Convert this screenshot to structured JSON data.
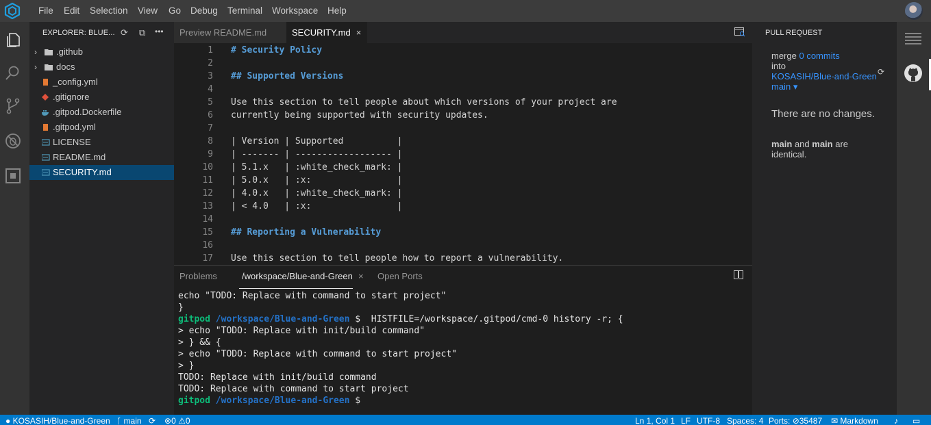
{
  "menu": {
    "items": [
      "File",
      "Edit",
      "Selection",
      "View",
      "Go",
      "Debug",
      "Terminal",
      "Workspace",
      "Help"
    ]
  },
  "activity_bar": {
    "icons": [
      "files-icon",
      "search-icon",
      "source-control-icon",
      "debug-icon",
      "extensions-icon"
    ]
  },
  "explorer": {
    "title": "EXPLORER: BLUE...",
    "items": [
      {
        "label": ".github",
        "type": "folder"
      },
      {
        "label": "docs",
        "type": "folder"
      },
      {
        "label": "_config.yml",
        "type": "yml"
      },
      {
        "label": ".gitignore",
        "type": "git"
      },
      {
        "label": ".gitpod.Dockerfile",
        "type": "docker"
      },
      {
        "label": ".gitpod.yml",
        "type": "yml"
      },
      {
        "label": "LICENSE",
        "type": "text"
      },
      {
        "label": "README.md",
        "type": "text"
      },
      {
        "label": "SECURITY.md",
        "type": "text",
        "selected": true
      }
    ]
  },
  "tabs": [
    {
      "label": "Preview README.md",
      "active": false
    },
    {
      "label": "SECURITY.md",
      "active": true,
      "close": "×"
    }
  ],
  "editor": {
    "lines": [
      {
        "num": "1",
        "text": "# Security Policy",
        "heading": true
      },
      {
        "num": "2",
        "text": ""
      },
      {
        "num": "3",
        "text": "## Supported Versions",
        "heading": true
      },
      {
        "num": "4",
        "text": ""
      },
      {
        "num": "5",
        "text": "Use this section to tell people about which versions of your project are"
      },
      {
        "num": "6",
        "text": "currently being supported with security updates."
      },
      {
        "num": "7",
        "text": ""
      },
      {
        "num": "8",
        "text": "| Version | Supported          |"
      },
      {
        "num": "9",
        "text": "| ------- | ------------------ |"
      },
      {
        "num": "10",
        "text": "| 5.1.x   | :white_check_mark: |"
      },
      {
        "num": "11",
        "text": "| 5.0.x   | :x:                |"
      },
      {
        "num": "12",
        "text": "| 4.0.x   | :white_check_mark: |"
      },
      {
        "num": "13",
        "text": "| < 4.0   | :x:                |"
      },
      {
        "num": "14",
        "text": ""
      },
      {
        "num": "15",
        "text": "## Reporting a Vulnerability",
        "heading": true
      },
      {
        "num": "16",
        "text": ""
      },
      {
        "num": "17",
        "text": "Use this section to tell people how to report a vulnerability."
      }
    ]
  },
  "panel": {
    "tabs": [
      "Problems",
      "/workspace/Blue-and-Green",
      "Open Ports"
    ],
    "active_tab": "/workspace/Blue-and-Green",
    "close": "×",
    "terminal_lines": [
      [
        {
          "t": "echo \"TODO: Replace with command to start project\""
        }
      ],
      [
        {
          "t": "}"
        }
      ],
      [
        {
          "t": "gitpod",
          "c": "green"
        },
        {
          "t": " "
        },
        {
          "t": "/workspace/Blue-and-Green",
          "c": "blue"
        },
        {
          "t": " $  HISTFILE=/workspace/.gitpod/cmd-0 history -r; {"
        }
      ],
      [
        {
          "t": "> echo \"TODO: Replace with init/build command\""
        }
      ],
      [
        {
          "t": "> } && {"
        }
      ],
      [
        {
          "t": "> echo \"TODO: Replace with command to start project\""
        }
      ],
      [
        {
          "t": "> }"
        }
      ],
      [
        {
          "t": "TODO: Replace with init/build command"
        }
      ],
      [
        {
          "t": "TODO: Replace with command to start project"
        }
      ],
      [
        {
          "t": "gitpod",
          "c": "green"
        },
        {
          "t": " "
        },
        {
          "t": "/workspace/Blue-and-Green",
          "c": "blue"
        },
        {
          "t": " $ "
        }
      ]
    ]
  },
  "pull_request": {
    "title": "PULL REQUEST",
    "merge_label": "merge",
    "commits_link": "0 commits",
    "into_label": "into",
    "repo_link": "KOSASIH/Blue-and-Green",
    "branch_link": "main",
    "branch_caret": "▾",
    "no_changes": "There are no changes.",
    "identical_a": "main",
    "identical_and": " and ",
    "identical_b": "main",
    "identical_rest": " are",
    "identical_last": "identical."
  },
  "status_bar": {
    "repo": "KOSASIH/Blue-and-Green",
    "branch": "main",
    "errors": "0",
    "warnings": "0",
    "position": "Ln 1, Col 1",
    "eol": "LF",
    "encoding": "UTF-8",
    "spaces": "Spaces: 4",
    "ports_label": "Ports:",
    "ports_value": "35487",
    "language": "Markdown"
  },
  "colors": {
    "accent": "#007acc",
    "selection": "#094771",
    "link": "#3794ff",
    "terminal_green": "#0dbc79",
    "terminal_blue": "#2472c8"
  }
}
